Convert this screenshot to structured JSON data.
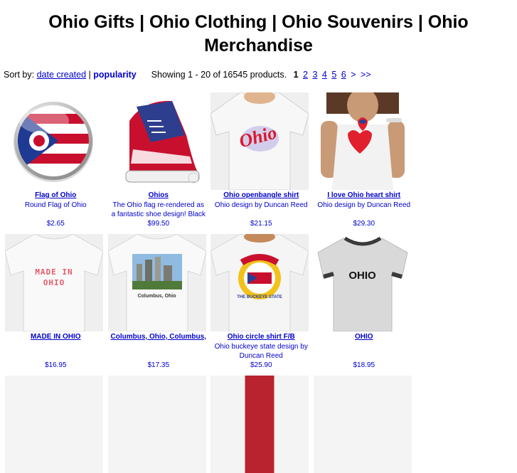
{
  "title": "Ohio Gifts | Ohio Clothing | Ohio Souvenirs | Ohio Merchandise",
  "sort": {
    "label": "Sort by:",
    "date_created": "date created",
    "separator": "|",
    "popularity": "popularity",
    "showing": "Showing 1 - 20 of 16545 products.",
    "pages": [
      "1",
      "2",
      "3",
      "4",
      "5",
      "6"
    ],
    "next": ">",
    "last": ">>"
  },
  "products": [
    {
      "name": "Flag of Ohio",
      "desc": "Round Flag of Ohio",
      "price": "$2.65",
      "icon": "button-badge-icon"
    },
    {
      "name": "Ohios",
      "desc": "The Ohio flag re-rendered as a fantastic shoe design! Black",
      "price": "$99.50",
      "icon": "sneaker-icon"
    },
    {
      "name": "Ohio openbangle shirt",
      "desc": "Ohio design by Duncan Reed",
      "price": "$21.15",
      "icon": "tshirt-icon"
    },
    {
      "name": "I love Ohio heart shirt",
      "desc": "Ohio design by Duncan Reed",
      "price": "$29.30",
      "icon": "tank-top-icon"
    },
    {
      "name": "MADE IN OHIO",
      "desc": "",
      "price": "$16.95",
      "icon": "tshirt-icon"
    },
    {
      "name": "Columbus, Ohio, Columbus,",
      "desc": "",
      "price": "$17.35",
      "icon": "tshirt-icon"
    },
    {
      "name": "Ohio circle shirt F/B",
      "desc": "Ohio buckeye state design by Duncan Reed",
      "price": "$25.90",
      "icon": "tshirt-icon"
    },
    {
      "name": "OHIO",
      "desc": "",
      "price": "$18.95",
      "icon": "ringer-tshirt-icon"
    }
  ],
  "shirt_text": {
    "ohio_logo": "Ohio",
    "made_in": "MADE IN",
    "made_in_state": "OHIO",
    "columbus": "Columbus, Ohio",
    "ringer": "OHIO",
    "circle_text": "THE BUCKEYE STATE"
  }
}
